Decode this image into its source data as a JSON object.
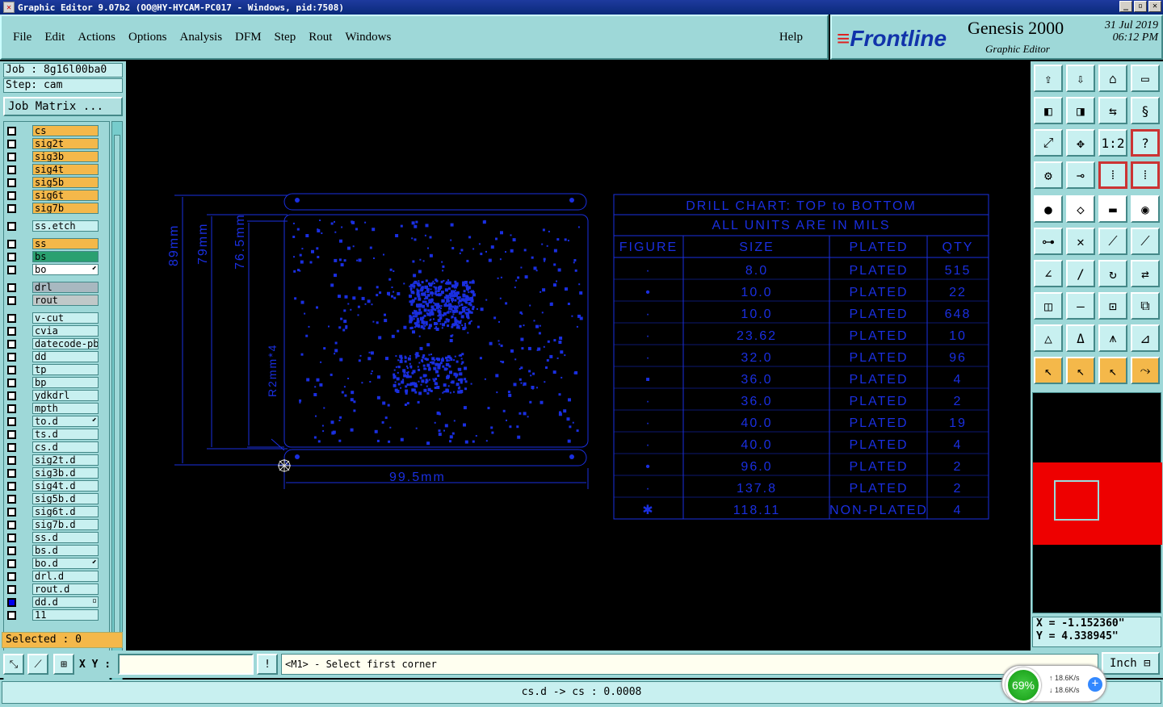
{
  "window": {
    "title": "Graphic Editor 9.07b2  (OO@HY-HYCAM-PC017 - Windows, pid:7508)"
  },
  "menu": {
    "items": [
      "File",
      "Edit",
      "Actions",
      "Options",
      "Analysis",
      "DFM",
      "Step",
      "Rout",
      "Windows"
    ],
    "help": "Help"
  },
  "brand": {
    "logo_a": "≡",
    "logo_b": "Frontline",
    "product": "Genesis 2000",
    "subtitle": "Graphic Editor",
    "date": "31 Jul 2019",
    "time": "06:12 PM"
  },
  "job": {
    "job_label": "Job : 8g16l00ba0",
    "step_label": "Step: cam",
    "matrix_button": "Job Matrix ..."
  },
  "layers": [
    {
      "name": "cs",
      "style": "sig"
    },
    {
      "name": "sig2t",
      "style": "sig"
    },
    {
      "name": "sig3b",
      "style": "sig"
    },
    {
      "name": "sig4t",
      "style": "sig"
    },
    {
      "name": "sig5b",
      "style": "sig"
    },
    {
      "name": "sig6t",
      "style": "sig"
    },
    {
      "name": "sig7b",
      "style": "sig"
    },
    {
      "name": "ss.etch",
      "style": ""
    },
    {
      "name": "ss",
      "style": "sig"
    },
    {
      "name": "bs",
      "style": "bs"
    },
    {
      "name": "bo",
      "style": "bo",
      "flag": "⬋"
    },
    {
      "name": "drl",
      "style": "drl"
    },
    {
      "name": "rout",
      "style": "rout"
    },
    {
      "name": "v-cut",
      "style": ""
    },
    {
      "name": "cvia",
      "style": ""
    },
    {
      "name": "datecode-pbc",
      "style": ""
    },
    {
      "name": "dd",
      "style": ""
    },
    {
      "name": "tp",
      "style": ""
    },
    {
      "name": "bp",
      "style": ""
    },
    {
      "name": "ydkdrl",
      "style": ""
    },
    {
      "name": "mpth",
      "style": ""
    },
    {
      "name": "to.d",
      "style": "",
      "flag": "⬋"
    },
    {
      "name": "ts.d",
      "style": ""
    },
    {
      "name": "cs.d",
      "style": ""
    },
    {
      "name": "sig2t.d",
      "style": ""
    },
    {
      "name": "sig3b.d",
      "style": ""
    },
    {
      "name": "sig4t.d",
      "style": ""
    },
    {
      "name": "sig5b.d",
      "style": ""
    },
    {
      "name": "sig6t.d",
      "style": ""
    },
    {
      "name": "sig7b.d",
      "style": ""
    },
    {
      "name": "ss.d",
      "style": ""
    },
    {
      "name": "bs.d",
      "style": ""
    },
    {
      "name": "bo.d",
      "style": "",
      "flag": "⬋"
    },
    {
      "name": "drl.d",
      "style": ""
    },
    {
      "name": "rout.d",
      "style": ""
    },
    {
      "name": "dd.d",
      "style": "",
      "active": true,
      "flag": "▫"
    },
    {
      "name": "11",
      "style": ""
    }
  ],
  "selected": "Selected : 0",
  "drawing": {
    "dim_89": "89mm",
    "dim_79": "79mm",
    "dim_765": "76.5mm",
    "dim_r2": "R2mm*4",
    "dim_995": "99.5mm",
    "chart_title1": "DRILL CHART: TOP to BOTTOM",
    "chart_title2": "ALL UNITS ARE IN MILS",
    "headers": [
      "FIGURE",
      "SIZE",
      "PLATED",
      "QTY"
    ],
    "rows": [
      [
        "·",
        "8.0",
        "PLATED",
        "515"
      ],
      [
        "•",
        "10.0",
        "PLATED",
        "22"
      ],
      [
        "·",
        "10.0",
        "PLATED",
        "648"
      ],
      [
        "·",
        "23.62",
        "PLATED",
        "10"
      ],
      [
        "·",
        "32.0",
        "PLATED",
        "96"
      ],
      [
        "▪",
        "36.0",
        "PLATED",
        "4"
      ],
      [
        "·",
        "36.0",
        "PLATED",
        "2"
      ],
      [
        "·",
        "40.0",
        "PLATED",
        "19"
      ],
      [
        "·",
        "40.0",
        "PLATED",
        "4"
      ],
      [
        "•",
        "96.0",
        "PLATED",
        "2"
      ],
      [
        "·",
        "137.8",
        "PLATED",
        "2"
      ],
      [
        "✱",
        "118.11",
        "NON-PLATED",
        "4"
      ]
    ]
  },
  "coords": {
    "x": "X = -1.152360\"",
    "y": "Y = 4.338945\""
  },
  "bottom": {
    "xy_label": "X Y :",
    "xy_value": "",
    "bang": "!",
    "prompt": "<M1> - Select first corner",
    "units": "Inch ⊟"
  },
  "status": "cs.d -> cs : 0.0008",
  "network": {
    "percent": "69%",
    "up": "18.6K/s",
    "down": "18.6K/s",
    "plus": "+"
  }
}
